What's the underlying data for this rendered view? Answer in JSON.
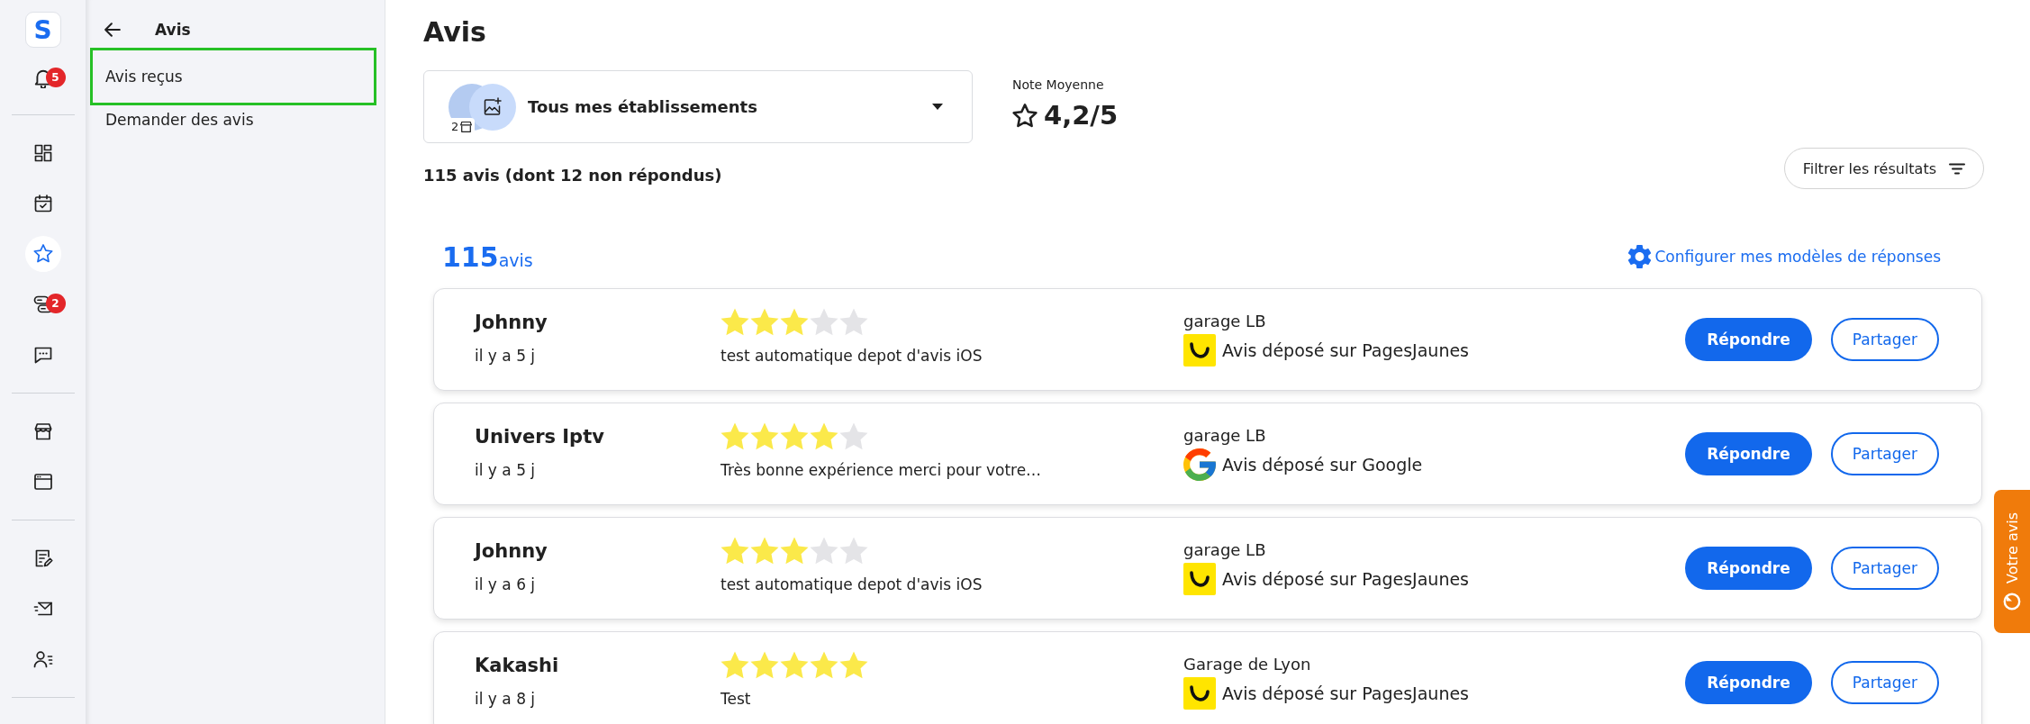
{
  "rail": {
    "logo": "S",
    "notifications": {
      "badge": "5"
    },
    "groups": [
      {
        "items": [
          {
            "selected": false
          },
          {
            "selected": false
          },
          {
            "selected": true
          },
          {
            "selected": false,
            "badge": "2"
          },
          {
            "selected": false
          }
        ]
      },
      {
        "items": [
          {
            "selected": false
          },
          {
            "selected": false
          }
        ]
      },
      {
        "items": [
          {
            "selected": false
          },
          {
            "selected": false
          },
          {
            "selected": false
          }
        ]
      }
    ]
  },
  "sidebar": {
    "title": "Avis",
    "items": [
      {
        "label": "Avis reçus",
        "selected": true
      },
      {
        "label": "Demander des avis",
        "selected": false
      }
    ]
  },
  "header": {
    "title": "Avis"
  },
  "establishment_select": {
    "value": "Tous mes établissements",
    "count": "2"
  },
  "rating_summary": {
    "label": "Note Moyenne",
    "value": "4,2/5"
  },
  "summary": "115 avis (dont 12 non répondus)",
  "filter_button": {
    "label": "Filtrer les résultats"
  },
  "list_header": {
    "count": "115",
    "unit": "avis",
    "templates_link": "Configurer mes modèles de réponses"
  },
  "reviews": [
    {
      "author": "Johnny",
      "date": "il y a 5 j",
      "stars": 3,
      "comment": "test automatique depot d'avis iOS",
      "location": "garage LB",
      "source": {
        "kind": "pagesjaunes",
        "label": "Avis déposé sur PagesJaunes"
      },
      "reply_label": "Répondre",
      "share_label": "Partager"
    },
    {
      "author": "Univers Iptv",
      "date": "il y a 5 j",
      "stars": 4,
      "comment": "Très bonne expérience merci pour votre…",
      "location": "garage LB",
      "source": {
        "kind": "google",
        "label": "Avis déposé sur Google"
      },
      "reply_label": "Répondre",
      "share_label": "Partager"
    },
    {
      "author": "Johnny",
      "date": "il y a 6 j",
      "stars": 3,
      "comment": "test automatique depot d'avis iOS",
      "location": "garage LB",
      "source": {
        "kind": "pagesjaunes",
        "label": "Avis déposé sur PagesJaunes"
      },
      "reply_label": "Répondre",
      "share_label": "Partager"
    },
    {
      "author": "Kakashi",
      "date": "il y a 8 j",
      "stars": 5,
      "comment": "Test",
      "location": "Garage de Lyon",
      "source": {
        "kind": "pagesjaunes",
        "label": "Avis déposé sur PagesJaunes"
      },
      "reply_label": "Répondre",
      "share_label": "Partager"
    }
  ],
  "feedback_tab": {
    "label": "Votre avis"
  }
}
